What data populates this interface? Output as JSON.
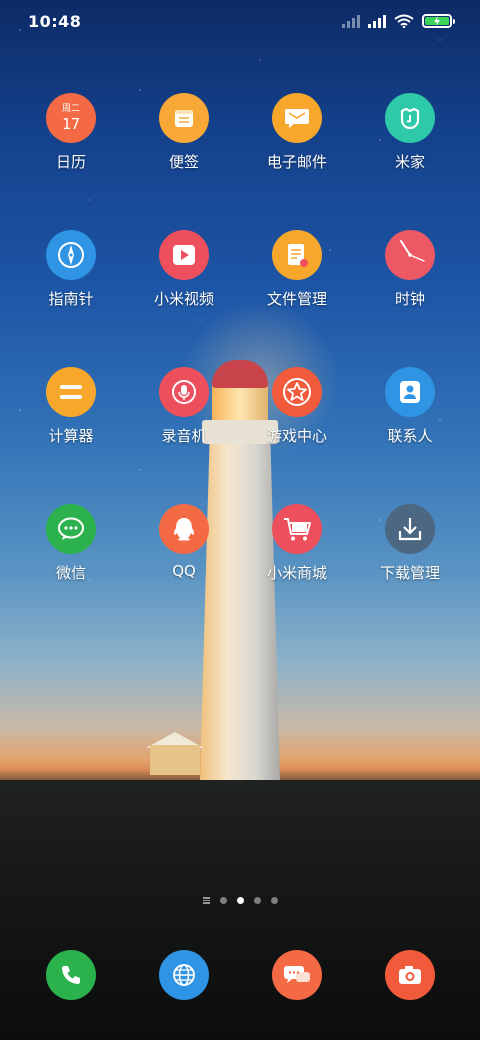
{
  "status_bar": {
    "time": "10:48",
    "icons": [
      "signal-off-icon",
      "signal-icon",
      "wifi-icon",
      "battery-charging-icon"
    ],
    "battery_color": "#3ed45a"
  },
  "apps": [
    {
      "id": "calendar",
      "label": "日历",
      "icon": "calendar-icon",
      "color": "#f36a45",
      "icon_text_top": "周二",
      "icon_text_bottom": "17"
    },
    {
      "id": "notes",
      "label": "便签",
      "icon": "notes-icon",
      "color": "#f7a836"
    },
    {
      "id": "email",
      "label": "电子邮件",
      "icon": "mail-icon",
      "color": "#f7a82c"
    },
    {
      "id": "mijia",
      "label": "米家",
      "icon": "mijia-icon",
      "color": "#2ec9a9"
    },
    {
      "id": "compass",
      "label": "指南针",
      "icon": "compass-icon",
      "color": "#2e94e3"
    },
    {
      "id": "mivideo",
      "label": "小米视频",
      "icon": "play-icon",
      "color": "#ee4f5d"
    },
    {
      "id": "files",
      "label": "文件管理",
      "icon": "file-icon",
      "color": "#f7a82c"
    },
    {
      "id": "clock",
      "label": "时钟",
      "icon": "clock-icon",
      "color": "#ec5864"
    },
    {
      "id": "calculator",
      "label": "计算器",
      "icon": "calculator-icon",
      "color": "#f7a82c"
    },
    {
      "id": "recorder",
      "label": "录音机",
      "icon": "microphone-icon",
      "color": "#ee4f5d"
    },
    {
      "id": "gamecenter",
      "label": "游戏中心",
      "icon": "star-icon",
      "color": "#f25a3c"
    },
    {
      "id": "contacts",
      "label": "联系人",
      "icon": "contact-icon",
      "color": "#2e94e3"
    },
    {
      "id": "wechat",
      "label": "微信",
      "icon": "wechat-icon",
      "color": "#2bb24c"
    },
    {
      "id": "qq",
      "label": "QQ",
      "icon": "qq-icon",
      "color": "#f36a45"
    },
    {
      "id": "mishop",
      "label": "小米商城",
      "icon": "cart-icon",
      "color": "#ee4f5d"
    },
    {
      "id": "downloads",
      "label": "下载管理",
      "icon": "download-icon",
      "color": "#4b6782"
    }
  ],
  "page_indicator": {
    "pages": 4,
    "active": 2
  },
  "dock": [
    {
      "id": "phone",
      "icon": "phone-icon",
      "color": "#2bb24c"
    },
    {
      "id": "browser",
      "icon": "globe-icon",
      "color": "#2e94e3"
    },
    {
      "id": "messages",
      "icon": "message-icon",
      "color": "#f36a45"
    },
    {
      "id": "camera",
      "icon": "camera-icon",
      "color": "#f25a3c"
    }
  ]
}
